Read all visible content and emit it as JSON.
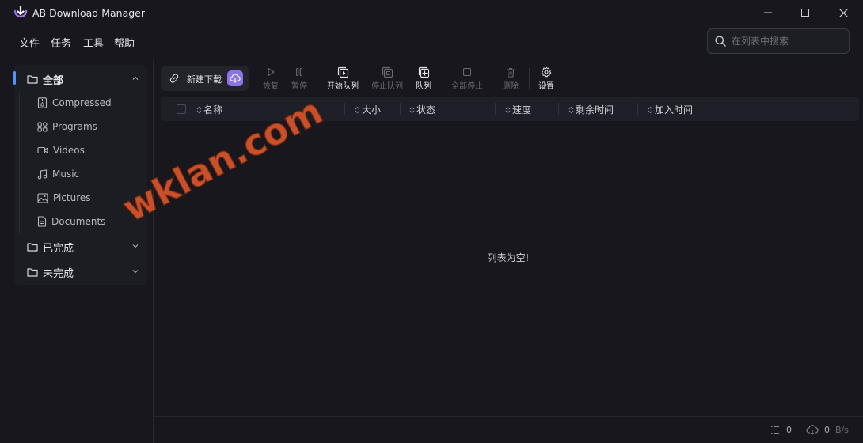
{
  "app": {
    "title": "AB Download Manager"
  },
  "menu": [
    "文件",
    "任务",
    "工具",
    "帮助"
  ],
  "search": {
    "placeholder": "在列表中搜索"
  },
  "sidebar": {
    "all": {
      "label": "全部"
    },
    "subcategories": [
      "Compressed",
      "Programs",
      "Videos",
      "Music",
      "Pictures",
      "Documents"
    ],
    "finished": {
      "label": "已完成"
    },
    "unfinished": {
      "label": "未完成"
    }
  },
  "toolbar": {
    "new_download": "新建下载",
    "resume": "恢复",
    "pause": "暂停",
    "start_queue": "开始队列",
    "stop_queue": "停止队列",
    "queues": "队列",
    "stop_all": "全部停止",
    "delete": "删除",
    "settings": "设置"
  },
  "table": {
    "columns": [
      "名称",
      "大小",
      "状态",
      "速度",
      "剩余时间",
      "加入时间"
    ],
    "empty_message": "列表为空!"
  },
  "watermark": "wklan.com",
  "status": {
    "active_count": "0",
    "speed_value": "0",
    "speed_unit": "B/s"
  },
  "colors": {
    "accent": "#5a8ef7",
    "brand_purple": "#8a74e8",
    "watermark": "#c8502a",
    "background": "#17171d"
  }
}
